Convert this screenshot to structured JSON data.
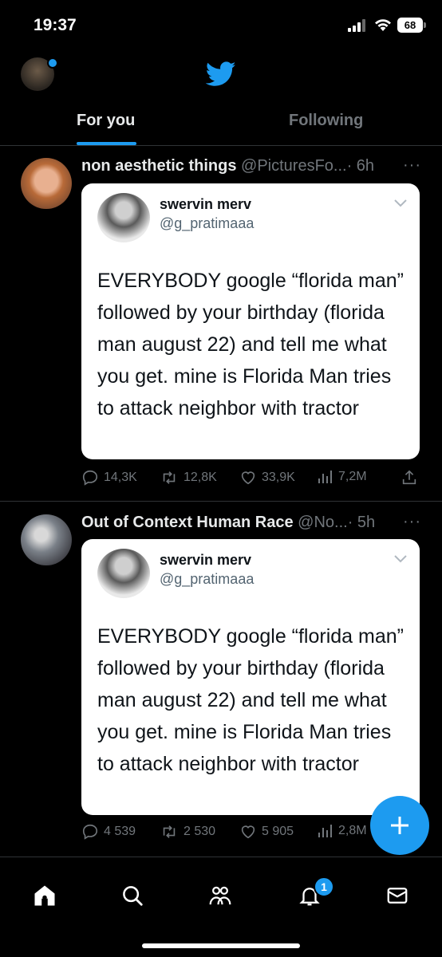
{
  "status_bar": {
    "time": "19:37",
    "battery": "68"
  },
  "tabs": [
    {
      "label": "For you"
    },
    {
      "label": "Following"
    }
  ],
  "notifications_badge": "1",
  "accent_color": "#1d9bf0",
  "tweets": [
    {
      "author_name": "non aesthetic things",
      "author_handle": "@PicturesFo...",
      "time": "· 6h",
      "more": "···",
      "quoted": {
        "name": "swervin merv",
        "handle": "@g_pratimaaa",
        "text": "EVERYBODY google “florida man” followed by your birthday (florida man august 22) and tell me what you get. mine is Florida Man tries to attack neighbor with tractor"
      },
      "replies": "14,3K",
      "retweets": "12,8K",
      "likes": "33,9K",
      "views": "7,2M"
    },
    {
      "author_name": "Out of Context Human Race",
      "author_handle": "@No...",
      "time": "· 5h",
      "more": "···",
      "quoted": {
        "name": "swervin merv",
        "handle": "@g_pratimaaa",
        "text": "EVERYBODY google “florida man” followed by your birthday (florida man august 22) and tell me what you get. mine is Florida Man tries to attack neighbor with tractor"
      },
      "replies": "4 539",
      "retweets": "2 530",
      "likes": "5 905",
      "views": "2,8M"
    }
  ],
  "icons": {
    "nav": [
      "home-icon",
      "search-icon",
      "communities-icon",
      "notifications-icon",
      "messages-icon"
    ],
    "fab": "plus-icon"
  }
}
